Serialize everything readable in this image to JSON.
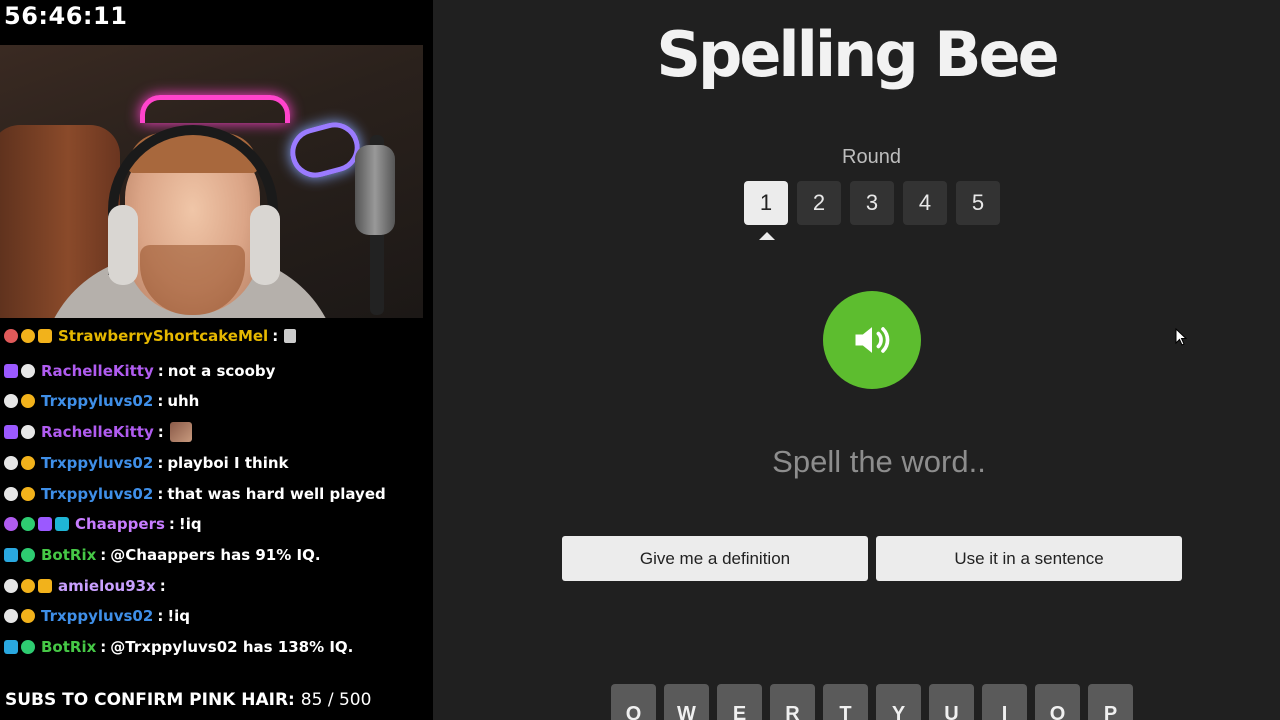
{
  "stream": {
    "timer": "56:46:11",
    "subs_goal": {
      "label": "SUBS TO CONFIRM PINK HAIR:",
      "count": "85 / 500"
    }
  },
  "chat": {
    "messages": [
      {
        "user": "StrawberryShortcakeMel",
        "message": "",
        "user_color": "#e6b800",
        "badges": [
          "moderator",
          "bits",
          "crown"
        ],
        "emote": "small"
      },
      {
        "user": "RachelleKitty",
        "message": "not a scooby",
        "user_color": "#b05cf0",
        "badges": [
          "sub-cube",
          "overwatch"
        ]
      },
      {
        "user": "Trxppyluvs02",
        "message": "uhh",
        "user_color": "#3f8fe8",
        "badges": [
          "overwatch",
          "bits"
        ]
      },
      {
        "user": "RachelleKitty",
        "message": "",
        "user_color": "#b05cf0",
        "badges": [
          "sub-cube",
          "overwatch"
        ],
        "emote": "face"
      },
      {
        "user": "Trxppyluvs02",
        "message": "playboi I think",
        "user_color": "#3f8fe8",
        "badges": [
          "overwatch",
          "bits"
        ]
      },
      {
        "user": "Trxppyluvs02",
        "message": "that was hard well played",
        "user_color": "#3f8fe8",
        "badges": [
          "overwatch",
          "bits"
        ]
      },
      {
        "user": "Chaappers",
        "message": "!iq",
        "user_color": "#c77dff",
        "badges": [
          "mic",
          "verified",
          "sub-cube",
          "grid"
        ]
      },
      {
        "user": "BotRix",
        "message": "@Chaappers has 91% IQ.",
        "user_color": "#46c846",
        "badges": [
          "bot",
          "verified"
        ]
      },
      {
        "user": "amielou93x",
        "message": "",
        "user_color": "#c9a0ff",
        "badges": [
          "overwatch",
          "bits",
          "crown"
        ]
      },
      {
        "user": "Trxppyluvs02",
        "message": "!iq",
        "user_color": "#3f8fe8",
        "badges": [
          "overwatch",
          "bits"
        ]
      },
      {
        "user": "BotRix",
        "message": "@Trxppyluvs02 has 138% IQ.",
        "user_color": "#46c846",
        "badges": [
          "bot",
          "verified"
        ]
      }
    ]
  },
  "game": {
    "title": "Spelling Bee",
    "round_label": "Round",
    "rounds": [
      "1",
      "2",
      "3",
      "4",
      "5"
    ],
    "active_round": "1",
    "speak_icon": "speaker-icon",
    "prompt": "Spell the word..",
    "definition_label": "Give me a definition",
    "sentence_label": "Use it in a sentence",
    "keyboard_row": [
      "Q",
      "W",
      "E",
      "R",
      "T",
      "Y",
      "U",
      "I",
      "O",
      "P"
    ],
    "colors": {
      "accent_green": "#5dbd2f",
      "panel_bg": "#202020",
      "button_bg": "#ececec"
    }
  }
}
